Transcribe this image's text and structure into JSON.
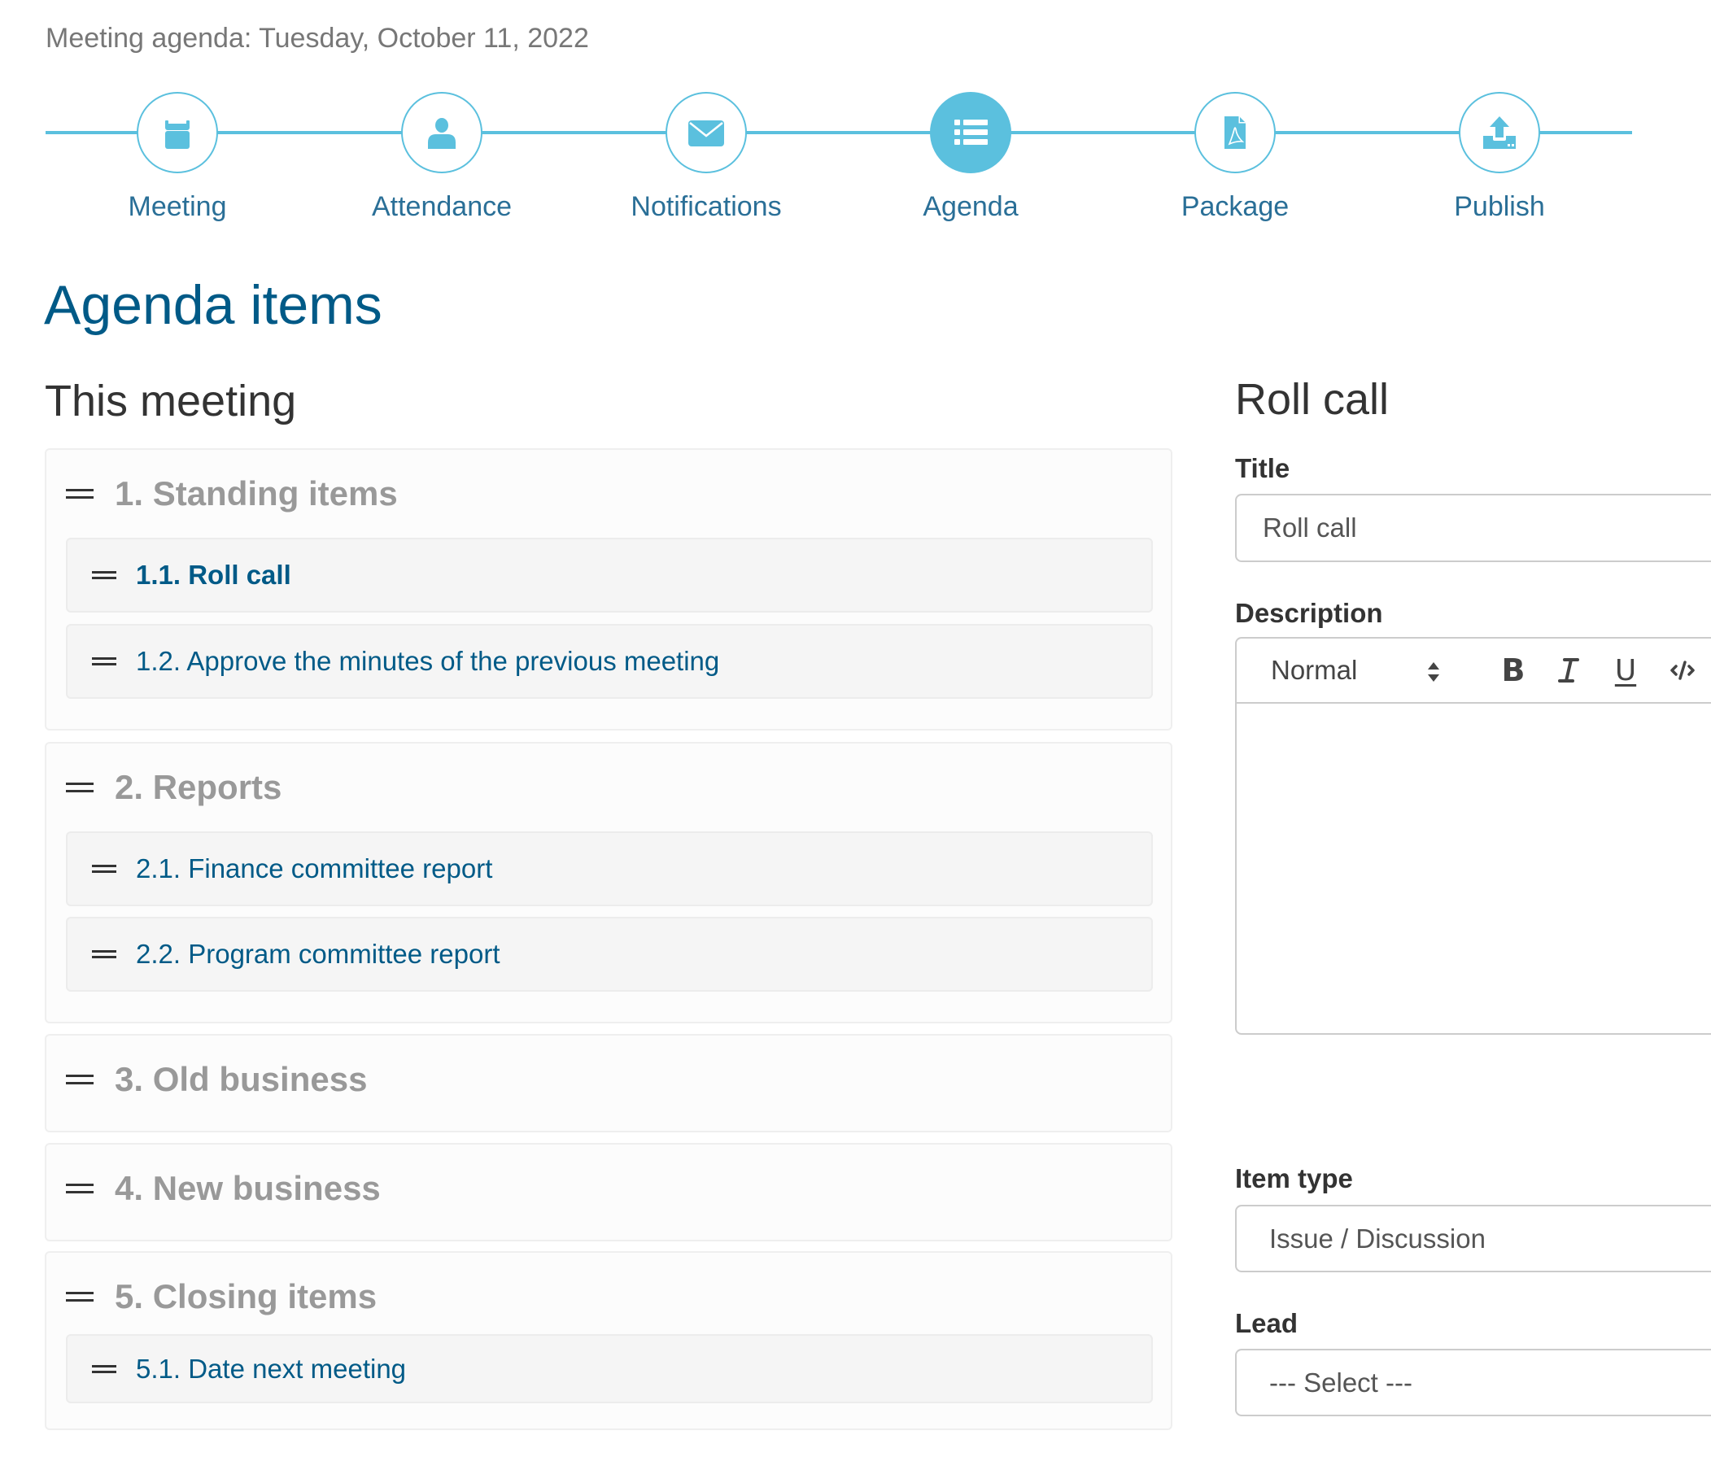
{
  "header": {
    "meeting_title": "Meeting agenda: Tuesday, October 11, 2022"
  },
  "colors": {
    "accent": "#5bc0de",
    "link": "#005a87",
    "section_label": "#999999"
  },
  "steps": [
    {
      "label": "Meeting",
      "icon": "calendar-icon",
      "active": false
    },
    {
      "label": "Attendance",
      "icon": "user-icon",
      "active": false
    },
    {
      "label": "Notifications",
      "icon": "envelope-icon",
      "active": false
    },
    {
      "label": "Agenda",
      "icon": "list-icon",
      "active": true
    },
    {
      "label": "Package",
      "icon": "pdf-file-icon",
      "active": false
    },
    {
      "label": "Publish",
      "icon": "upload-icon",
      "active": false
    }
  ],
  "page_title": "Agenda items",
  "left_column": {
    "title": "This meeting",
    "sections": [
      {
        "label": "1. Standing items",
        "items": [
          {
            "label": "1.1. Roll call",
            "selected": true
          },
          {
            "label": "1.2. Approve the minutes of the previous meeting",
            "selected": false
          }
        ]
      },
      {
        "label": "2. Reports",
        "items": [
          {
            "label": "2.1. Finance committee report",
            "selected": false
          },
          {
            "label": "2.2. Program committee report",
            "selected": false
          }
        ]
      },
      {
        "label": "3. Old business",
        "items": []
      },
      {
        "label": "4. New business",
        "items": []
      },
      {
        "label": "5. Closing items",
        "items": [
          {
            "label": "5.1. Date next meeting",
            "selected": false
          }
        ]
      }
    ]
  },
  "right_column": {
    "title": "Roll call",
    "title_label": "Title",
    "title_value": "Roll call",
    "description_label": "Description",
    "editor": {
      "format_value": "Normal",
      "bold_label": "B",
      "italic_label": "I",
      "underline_label": "U",
      "code_label": "</>"
    },
    "item_type_label": "Item type",
    "item_type_value": "Issue / Discussion",
    "lead_label": "Lead",
    "lead_value": "--- Select ---"
  }
}
